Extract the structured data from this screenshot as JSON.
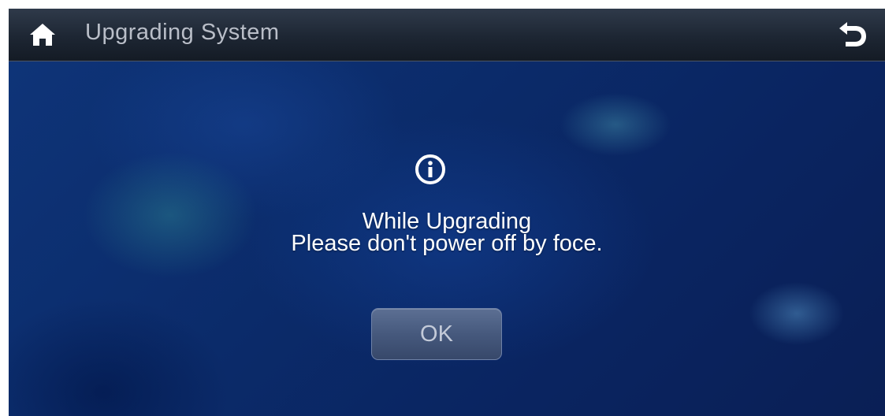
{
  "header": {
    "title": "Upgrading System",
    "home_icon": "home-icon",
    "back_icon": "back-arrow-icon"
  },
  "dialog": {
    "icon": "info-icon",
    "message_line1": "While Upgrading",
    "message_line2": "Please don't power off by foce.",
    "ok_label": "OK"
  },
  "colors": {
    "header_text": "#b9bec8",
    "background": "#0d2a6e",
    "message_text": "#ffffff",
    "button_text": "#c3cad8"
  }
}
